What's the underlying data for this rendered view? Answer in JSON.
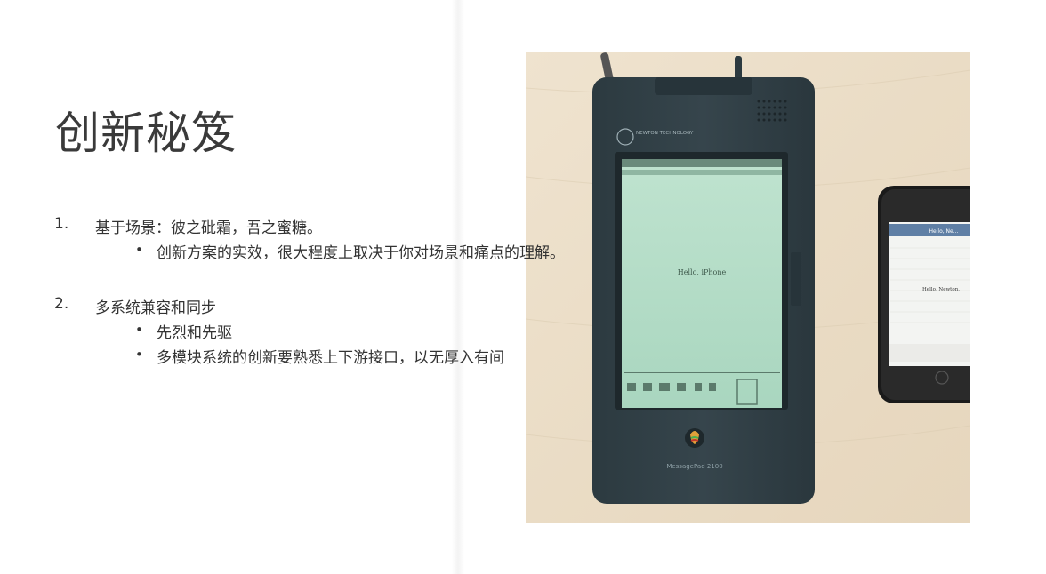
{
  "slide": {
    "title": "创新秘笈",
    "items": [
      {
        "number": "1.",
        "text": "基于场景：彼之砒霜，吾之蜜糖。",
        "subitems": [
          "创新方案的实效，很大程度上取决于你对场景和痛点的理解。"
        ]
      },
      {
        "number": "2.",
        "text": "多系统兼容和同步",
        "subitems": [
          "先烈和先驱",
          "多模块系统的创新要熟悉上下游接口，以无厚入有间"
        ]
      }
    ],
    "bullet_glyph": "•"
  },
  "photo": {
    "newton_brand": "NEWTON TECHNOLOGY",
    "newton_screen_text": "Hello, iPhone",
    "newton_model": "MessagePad 2100",
    "iphone_header": "Hello, Ne...",
    "iphone_body": "Hello, Newton."
  }
}
